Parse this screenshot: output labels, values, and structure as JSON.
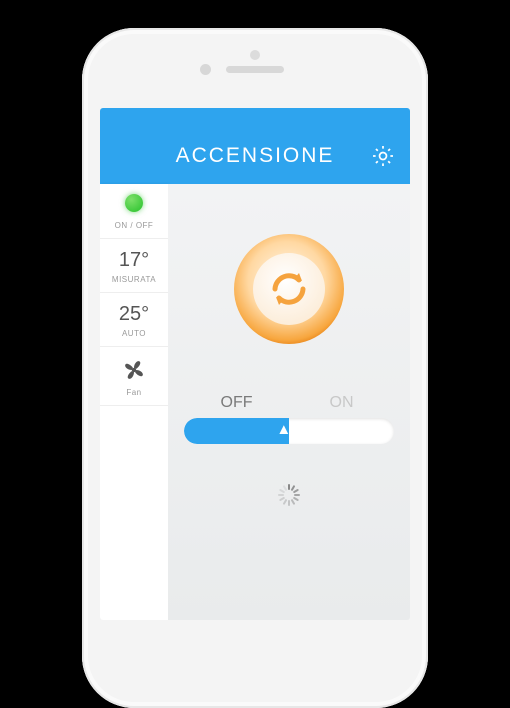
{
  "header": {
    "title": "ACCENSIONE"
  },
  "sidebar": {
    "onoff_label": "ON / OFF",
    "measured": {
      "value": "17°",
      "label": "MISURATA"
    },
    "setpoint": {
      "value": "25°",
      "label": "AUTO"
    },
    "fan": {
      "label": "Fan"
    }
  },
  "slider": {
    "off": "OFF",
    "on": "ON",
    "state": "OFF"
  },
  "colors": {
    "accent": "#2ea4ee",
    "power": "#f5a33e"
  }
}
